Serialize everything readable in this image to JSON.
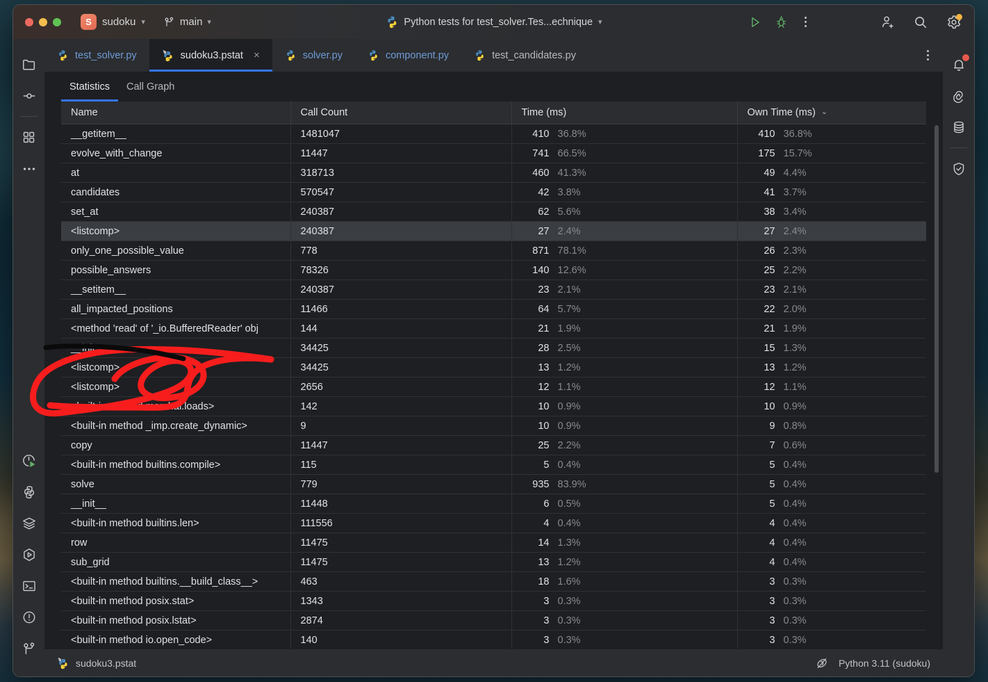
{
  "titlebar": {
    "project_badge": "S",
    "project_name": "sudoku",
    "branch": "main",
    "run_config": "Python tests for test_solver.Tes...echnique",
    "icons": {
      "project_chevron": "chevron-down-icon",
      "branch_icon": "git-branch-icon",
      "branch_chevron": "chevron-down-icon",
      "run_config_icon": "python-icon",
      "run_config_chevron": "chevron-down-icon",
      "run": "run-icon",
      "debug": "debug-icon",
      "more": "more-vertical-icon",
      "add_user": "add-user-icon",
      "search": "search-icon",
      "settings": "settings-icon"
    }
  },
  "left_strip": [
    {
      "name": "project-tool-window",
      "icon": "folder-icon"
    },
    {
      "name": "commit-tool-window",
      "icon": "commit-icon"
    },
    {
      "name": "plugins-tool-window",
      "icon": "grid-icon"
    },
    {
      "name": "more-tool-windows",
      "icon": "ellipsis-icon"
    }
  ],
  "left_strip_bottom": [
    {
      "name": "profiler-tool-window",
      "icon": "profiler-icon"
    },
    {
      "name": "python-packages-tool-window",
      "icon": "python-icon"
    },
    {
      "name": "database-layers-tool-window",
      "icon": "layers-icon"
    },
    {
      "name": "run-tool-window",
      "icon": "run-hex-icon"
    },
    {
      "name": "terminal-tool-window",
      "icon": "terminal-icon"
    },
    {
      "name": "problems-tool-window",
      "icon": "warning-circle-icon"
    },
    {
      "name": "version-control-tool-window",
      "icon": "git-branch-icon"
    }
  ],
  "right_strip": [
    {
      "name": "notifications",
      "icon": "bell-icon",
      "badge": true
    },
    {
      "name": "ai-assistant",
      "icon": "spiral-icon",
      "badge": false
    },
    {
      "name": "database",
      "icon": "database-icon",
      "badge": false
    },
    {
      "name": "security-analysis",
      "icon": "shield-check-icon",
      "badge": false
    }
  ],
  "editor_tabs": [
    {
      "label": "test_solver.py",
      "icon": "python-file-icon",
      "active": false,
      "closable": false
    },
    {
      "label": "sudoku3.pstat",
      "icon": "pstat-file-icon",
      "active": true,
      "closable": true
    },
    {
      "label": "solver.py",
      "icon": "python-file-icon",
      "active": false,
      "closable": false
    },
    {
      "label": "component.py",
      "icon": "python-file-icon",
      "active": false,
      "closable": false
    },
    {
      "label": "test_candidates.py",
      "icon": "python-file-icon",
      "active": false,
      "closable": false
    }
  ],
  "tab_close_glyph": "×",
  "panel_tabs": [
    {
      "label": "Statistics",
      "active": true
    },
    {
      "label": "Call Graph",
      "active": false
    }
  ],
  "table": {
    "columns": [
      "Name",
      "Call Count",
      "Time (ms)",
      "Own Time (ms)"
    ],
    "sorted_column": "Own Time (ms)",
    "sort_direction": "desc",
    "sort_glyph": "⌄",
    "rows": [
      {
        "name": "__getitem__",
        "calls": "1481047",
        "time": "410",
        "time_pct": "36.8%",
        "own": "410",
        "own_pct": "36.8%",
        "selected": false
      },
      {
        "name": "evolve_with_change",
        "calls": "11447",
        "time": "741",
        "time_pct": "66.5%",
        "own": "175",
        "own_pct": "15.7%",
        "selected": false
      },
      {
        "name": "at",
        "calls": "318713",
        "time": "460",
        "time_pct": "41.3%",
        "own": "49",
        "own_pct": "4.4%",
        "selected": false
      },
      {
        "name": "candidates",
        "calls": "570547",
        "time": "42",
        "time_pct": "3.8%",
        "own": "41",
        "own_pct": "3.7%",
        "selected": false
      },
      {
        "name": "set_at",
        "calls": "240387",
        "time": "62",
        "time_pct": "5.6%",
        "own": "38",
        "own_pct": "3.4%",
        "selected": false
      },
      {
        "name": "<listcomp>",
        "calls": "240387",
        "time": "27",
        "time_pct": "2.4%",
        "own": "27",
        "own_pct": "2.4%",
        "selected": true
      },
      {
        "name": "only_one_possible_value",
        "calls": "778",
        "time": "871",
        "time_pct": "78.1%",
        "own": "26",
        "own_pct": "2.3%",
        "selected": false
      },
      {
        "name": "possible_answers",
        "calls": "78326",
        "time": "140",
        "time_pct": "12.6%",
        "own": "25",
        "own_pct": "2.2%",
        "selected": false
      },
      {
        "name": "__setitem__",
        "calls": "240387",
        "time": "23",
        "time_pct": "2.1%",
        "own": "23",
        "own_pct": "2.1%",
        "selected": false
      },
      {
        "name": "all_impacted_positions",
        "calls": "11466",
        "time": "64",
        "time_pct": "5.7%",
        "own": "22",
        "own_pct": "2.0%",
        "selected": false
      },
      {
        "name": "<method 'read' of '_io.BufferedReader' obj",
        "calls": "144",
        "time": "21",
        "time_pct": "1.9%",
        "own": "21",
        "own_pct": "1.9%",
        "selected": false
      },
      {
        "name": "__init__",
        "calls": "34425",
        "time": "28",
        "time_pct": "2.5%",
        "own": "15",
        "own_pct": "1.3%",
        "selected": false
      },
      {
        "name": "<listcomp>",
        "calls": "34425",
        "time": "13",
        "time_pct": "1.2%",
        "own": "13",
        "own_pct": "1.2%",
        "selected": false
      },
      {
        "name": "<listcomp>",
        "calls": "2656",
        "time": "12",
        "time_pct": "1.1%",
        "own": "12",
        "own_pct": "1.1%",
        "selected": false
      },
      {
        "name": "<built-in method marshal.loads>",
        "calls": "142",
        "time": "10",
        "time_pct": "0.9%",
        "own": "10",
        "own_pct": "0.9%",
        "selected": false
      },
      {
        "name": "<built-in method _imp.create_dynamic>",
        "calls": "9",
        "time": "10",
        "time_pct": "0.9%",
        "own": "9",
        "own_pct": "0.8%",
        "selected": false
      },
      {
        "name": "copy",
        "calls": "11447",
        "time": "25",
        "time_pct": "2.2%",
        "own": "7",
        "own_pct": "0.6%",
        "selected": false
      },
      {
        "name": "<built-in method builtins.compile>",
        "calls": "115",
        "time": "5",
        "time_pct": "0.4%",
        "own": "5",
        "own_pct": "0.4%",
        "selected": false
      },
      {
        "name": "solve",
        "calls": "779",
        "time": "935",
        "time_pct": "83.9%",
        "own": "5",
        "own_pct": "0.4%",
        "selected": false
      },
      {
        "name": "__init__",
        "calls": "11448",
        "time": "6",
        "time_pct": "0.5%",
        "own": "5",
        "own_pct": "0.4%",
        "selected": false
      },
      {
        "name": "<built-in method builtins.len>",
        "calls": "111556",
        "time": "4",
        "time_pct": "0.4%",
        "own": "4",
        "own_pct": "0.4%",
        "selected": false
      },
      {
        "name": "row",
        "calls": "11475",
        "time": "14",
        "time_pct": "1.3%",
        "own": "4",
        "own_pct": "0.4%",
        "selected": false
      },
      {
        "name": "sub_grid",
        "calls": "11475",
        "time": "13",
        "time_pct": "1.2%",
        "own": "4",
        "own_pct": "0.4%",
        "selected": false
      },
      {
        "name": "<built-in method builtins.__build_class__>",
        "calls": "463",
        "time": "18",
        "time_pct": "1.6%",
        "own": "3",
        "own_pct": "0.3%",
        "selected": false
      },
      {
        "name": "<built-in method posix.stat>",
        "calls": "1343",
        "time": "3",
        "time_pct": "0.3%",
        "own": "3",
        "own_pct": "0.3%",
        "selected": false
      },
      {
        "name": "<built-in method posix.lstat>",
        "calls": "2874",
        "time": "3",
        "time_pct": "0.3%",
        "own": "3",
        "own_pct": "0.3%",
        "selected": false
      },
      {
        "name": "<built-in method io.open_code>",
        "calls": "140",
        "time": "3",
        "time_pct": "0.3%",
        "own": "3",
        "own_pct": "0.3%",
        "selected": false
      }
    ]
  },
  "status_bar": {
    "file_icon": "pstat-file-icon",
    "file_label": "sudoku3.pstat",
    "interpreter_icon": "no-inspections-icon",
    "interpreter_label": "Python 3.11 (sudoku)"
  },
  "annotation": {
    "present": true,
    "ink_color": "#f71d1d",
    "secondary_ink_color": "#0a0a0a",
    "describes": "hand-drawn red loop circling the __init__ and two <listcomp> rows"
  },
  "colors": {
    "accent": "#3574f0",
    "window_bg": "#2b2d30",
    "editor_bg": "#1e1f22",
    "text": "#dfe1e5",
    "muted_text": "#878a8e",
    "link_blue": "#6f9bd6",
    "run_green": "#5fad65"
  }
}
